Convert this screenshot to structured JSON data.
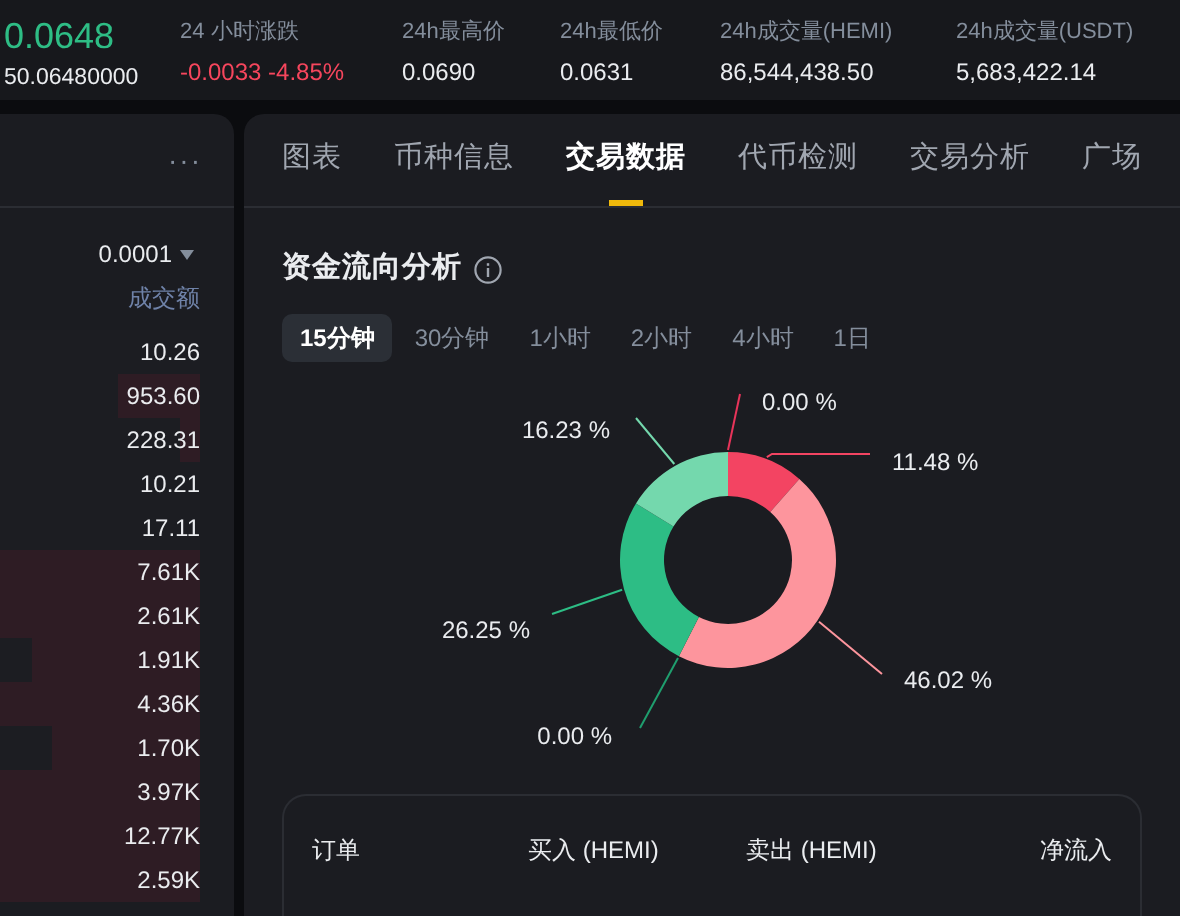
{
  "ticker": {
    "price": "0.0648",
    "sub_price": "50.06480000"
  },
  "stats": [
    {
      "label": "24 小时涨跌",
      "value": "-0.0033 -4.85%",
      "negative": true
    },
    {
      "label": "24h最高价",
      "value": "0.0690",
      "negative": false
    },
    {
      "label": "24h最低价",
      "value": "0.0631",
      "negative": false
    },
    {
      "label": "24h成交量(HEMI)",
      "value": "86,544,438.50",
      "negative": false
    },
    {
      "label": "24h成交量(USDT)",
      "value": "5,683,422.14",
      "negative": false
    }
  ],
  "order_book": {
    "more": "···",
    "precision": "0.0001",
    "column": "成交额",
    "rows": [
      {
        "amount": "10.26"
      },
      {
        "amount": "953.60",
        "level": 0.41
      },
      {
        "amount": "228.31",
        "level": 0.1
      },
      {
        "amount": "10.21"
      },
      {
        "amount": "17.11"
      },
      {
        "amount": "7.61K",
        "level": 1
      },
      {
        "amount": "2.61K",
        "level": 1
      },
      {
        "amount": "1.91K",
        "level": 0.84
      },
      {
        "amount": "4.36K",
        "level": 1
      },
      {
        "amount": "1.70K",
        "level": 0.74
      },
      {
        "amount": "3.97K",
        "level": 1
      },
      {
        "amount": "12.77K",
        "level": 1
      },
      {
        "amount": "2.59K",
        "level": 1
      }
    ]
  },
  "tabs": [
    {
      "label": "图表",
      "selected": false
    },
    {
      "label": "币种信息",
      "selected": false
    },
    {
      "label": "交易数据",
      "selected": true
    },
    {
      "label": "代币检测",
      "selected": false
    },
    {
      "label": "交易分析",
      "selected": false
    },
    {
      "label": "广场",
      "selected": false
    }
  ],
  "fund_flow": {
    "title": "资金流向分析",
    "periods": [
      {
        "label": "15分钟",
        "selected": true
      },
      {
        "label": "30分钟",
        "selected": false
      },
      {
        "label": "1小时",
        "selected": false
      },
      {
        "label": "2小时",
        "selected": false
      },
      {
        "label": "4小时",
        "selected": false
      },
      {
        "label": "1日",
        "selected": false
      }
    ],
    "chart_data": {
      "type": "donut",
      "values": [
        0,
        11.48,
        46.02,
        0,
        26.25,
        16.23
      ],
      "colors": [
        "#e8345a",
        "#f34462",
        "#fd959d",
        "#1f9e6e",
        "#2dbd85",
        "#74d8ad"
      ],
      "value_labels": [
        "0.00 %",
        "11.48 %",
        "46.02 %",
        "0.00 %",
        "26.25 %",
        "16.23 %"
      ]
    },
    "table": {
      "columns": [
        "订单",
        "买入 (HEMI)",
        "卖出 (HEMI)",
        "净流入"
      ]
    }
  }
}
